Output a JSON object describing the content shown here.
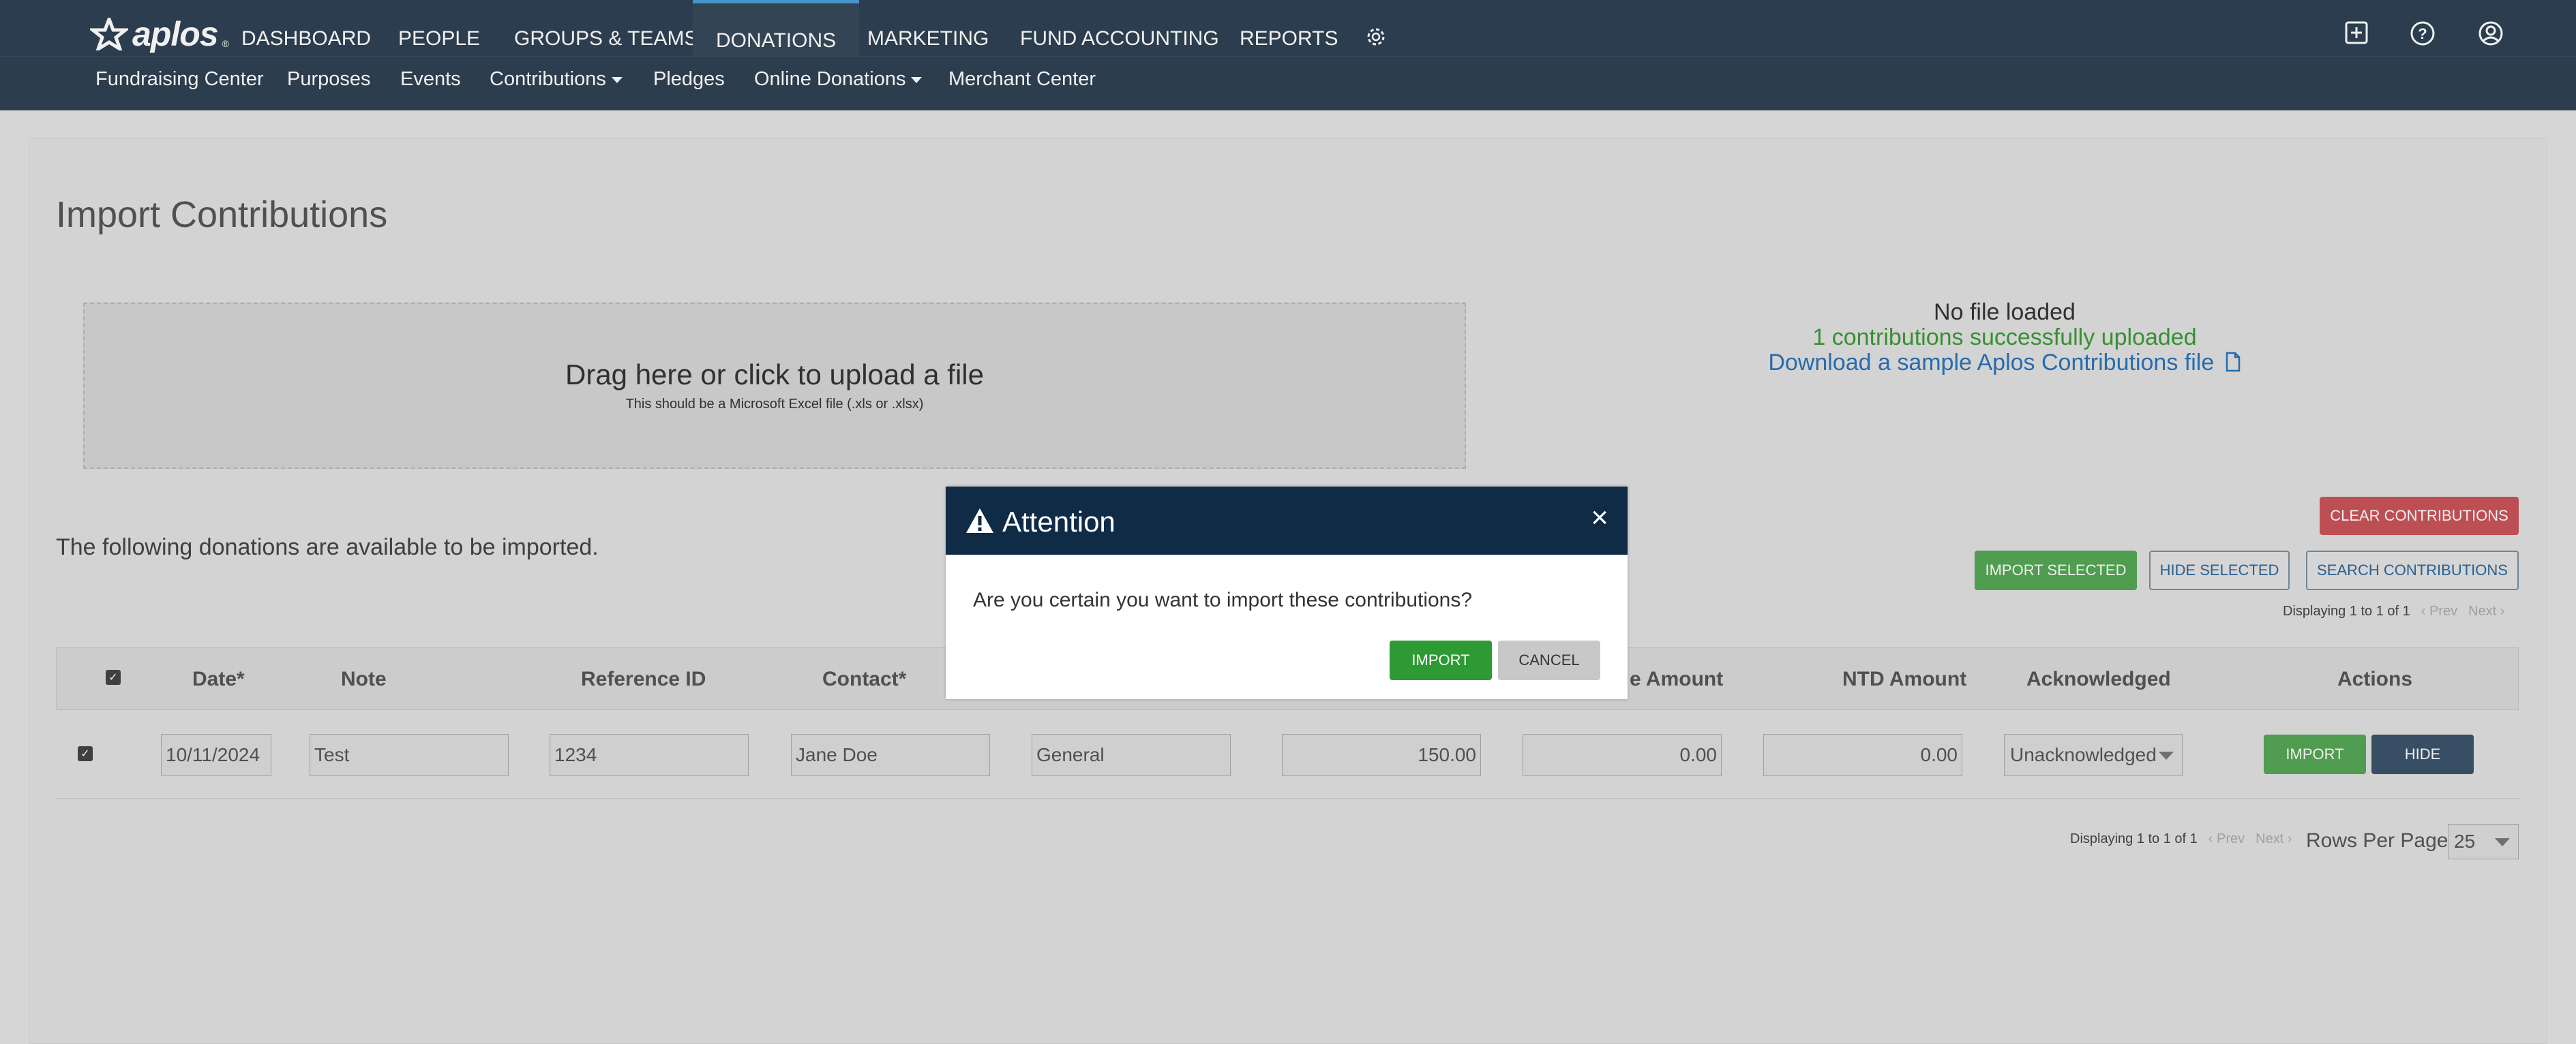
{
  "brand": {
    "name": "aplos",
    "reg": "®"
  },
  "nav": {
    "items": [
      "DASHBOARD",
      "PEOPLE",
      "GROUPS & TEAMS",
      "DONATIONS",
      "MARKETING",
      "FUND ACCOUNTING",
      "REPORTS"
    ],
    "active": "DONATIONS",
    "icons": [
      "gear-icon",
      "plus-square-icon",
      "help-icon",
      "user-circle-icon"
    ]
  },
  "subnav": {
    "items": [
      "Fundraising Center",
      "Purposes",
      "Events",
      "Contributions",
      "Pledges",
      "Online Donations",
      "Merchant Center"
    ]
  },
  "page": {
    "title": "Import Contributions",
    "dropzone_main": "Drag here or click to upload a file",
    "dropzone_sub": "This should be a Microsoft Excel file (.xls or .xlsx)",
    "status_no_file": "No file loaded",
    "status_uploaded": "1 contributions successfully uploaded",
    "status_sample_link": "Download a sample Aplos Contributions file",
    "available_text": "The following donations are available to be imported."
  },
  "buttons": {
    "clear": "CLEAR CONTRIBUTIONS",
    "import_selected": "IMPORT SELECTED",
    "hide_selected": "HIDE SELECTED",
    "search": "SEARCH CONTRIBUTIONS",
    "row_import": "IMPORT",
    "row_hide": "HIDE"
  },
  "pager": {
    "top_display": "Displaying 1 to 1 of 1",
    "prev": "‹ Prev",
    "next": "Next ›",
    "bottom_display": "Displaying 1 to 1 of 1",
    "bottom_prev": "‹ Prev",
    "bottom_next": "Next ›",
    "rows_per_page_label": "Rows Per Page:",
    "rows_per_page_value": "25"
  },
  "table": {
    "headers": {
      "date": "Date*",
      "note": "Note",
      "reference": "Reference ID",
      "contact": "Contact*",
      "amount_partial": "e Amount",
      "ntd": "NTD Amount",
      "acknowledged": "Acknowledged",
      "actions": "Actions"
    },
    "row": {
      "date": "10/11/2024",
      "note": "Test",
      "reference": "1234",
      "contact": "Jane Doe",
      "fund": "General",
      "amount": "150.00",
      "deductible": "0.00",
      "ntd": "0.00",
      "acknowledged": "Unacknowledged"
    }
  },
  "modal": {
    "title": "Attention",
    "message": "Are you certain you want to import these contributions?",
    "import": "IMPORT",
    "cancel": "CANCEL"
  }
}
